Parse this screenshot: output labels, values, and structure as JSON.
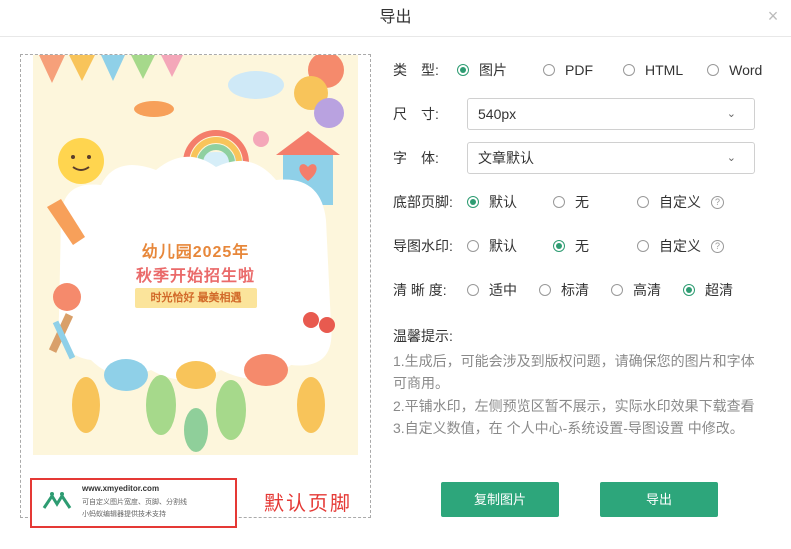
{
  "dialog": {
    "title": "导出"
  },
  "preview": {
    "poster_line1": "幼儿园2025年",
    "poster_line2": "秋季开始招生啦",
    "poster_tagline": "时光恰好 最美相遇",
    "footer_line1": "www.xmyeditor.com",
    "footer_line2": "可自定义图片宽度、页脚、分割线",
    "footer_line3": "小蚂蚁编辑器提供技术支持",
    "annotation": "默认页脚"
  },
  "form": {
    "type": {
      "label": "类　型:",
      "options": [
        "图片",
        "PDF",
        "HTML",
        "Word"
      ],
      "selected": 0
    },
    "size": {
      "label": "尺　寸:",
      "value": "540px"
    },
    "font": {
      "label": "字　体:",
      "value": "文章默认"
    },
    "footer": {
      "label": "底部页脚:",
      "options": [
        "默认",
        "无",
        "自定义"
      ],
      "selected": 0
    },
    "watermark": {
      "label": "导图水印:",
      "options": [
        "默认",
        "无",
        "自定义"
      ],
      "selected": 1
    },
    "clarity": {
      "label": "清 晰 度:",
      "options": [
        "适中",
        "标清",
        "高清",
        "超清"
      ],
      "selected": 3
    }
  },
  "tips": {
    "title": "温馨提示:",
    "line1": "1.生成后，可能会涉及到版权问题，请确保您的图片和字体可商用。",
    "line2": "2.平铺水印，左侧预览区暂不展示，实际水印效果下载查看",
    "line3": "3.自定义数值，在 个人中心-系统设置-导图设置 中修改。"
  },
  "buttons": {
    "copy": "复制图片",
    "export": "导出"
  },
  "colors": {
    "accent": "#2da67b",
    "annotation": "#e53935"
  },
  "icons": {
    "help": "?",
    "close": "×",
    "chevron": "⌄"
  }
}
